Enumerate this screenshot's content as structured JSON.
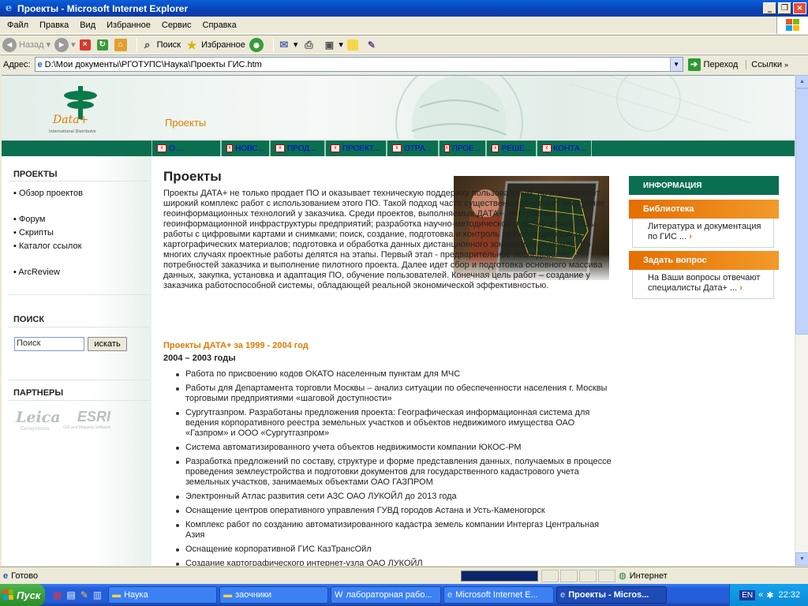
{
  "window": {
    "title": "Проекты - Microsoft Internet Explorer"
  },
  "menu": [
    "Файл",
    "Правка",
    "Вид",
    "Избранное",
    "Сервис",
    "Справка"
  ],
  "toolbar": {
    "back": "Назад",
    "search": "Поиск",
    "favorites": "Избранное"
  },
  "address": {
    "label": "Адрес:",
    "value": "D:\\Мои документы\\РГОТУПС\\Наука\\Проекты ГИС.htm",
    "go": "Переход",
    "links": "Ссылки"
  },
  "page": {
    "logo_text": "Data+",
    "logo_sub": "International Distributor",
    "header_title": "Проекты",
    "nav": [
      "О ...",
      "НОВС...",
      "ПРОД...",
      "ПРОЕКТ...",
      "ОТРА...",
      "ПРОЕ...",
      "РЕШЕ...",
      "КОНТА..."
    ],
    "sidebar": {
      "projects_heading": "ПРОЕКТЫ",
      "projects_links": [
        "Обзор проектов",
        "Форум",
        "Скрипты",
        "Каталог ссылок",
        "ArcReview"
      ],
      "search_heading": "ПОИСК",
      "search_value": "Поиск",
      "search_button": "искать",
      "partners_heading": "ПАРТНЕРЫ",
      "partner1": "Leica",
      "partner1_sub": "Geosystems",
      "partner2": "ESRI",
      "partner2_sub": "GIS and Mapping Software"
    },
    "title": "Проекты",
    "intro": "Проекты ДАТА+ не только продает ПО и оказывает техническую поддержку пользователям, но и выполняет широкий комплекс работ с использованием этого ПО. Такой подход часто существенно облегчает внедрение геоинформационных технологий у заказчика. Среди проектов, выполняемых ДАТА+, построение геоинформационной инфраструктуры предприятий; разработка научно-методической и нормативной базы работы с цифровыми картами и снимками; поиск, создание, подготовка и контроль качества цифровых картографических материалов; подготовка и обработка данных дистанционного зондирования Земли. Во многих случаях проектные работы делятся на этапы. Первый этап - предварительное исследование потребностей заказчика и выполнение пилотного проекта. Далее идет сбор и подготовка основного массива данных, закупка, установка и адаптация ПО, обучение пользователей. Конечная цель работ – создание у заказчика работоспособной системы, обладающей реальной экономической эффективностью.",
    "section_heading": "Проекты ДАТА+ за 1999 - 2004 год",
    "section_sub": "2004 – 2003 годы",
    "items": [
      "Работа по присвоению кодов ОКАТО населенным пунктам для МЧС",
      "Работы для Департамента торговли Москвы – анализ ситуации по обеспеченности населения г. Москвы торговыми предприятиями «шаговой доступности»",
      "Сургутгазпром. Разработаны предложения проекта: Географическая информационная система для ведения корпоративного реестра земельных участков и объектов недвижимого имущества ОАО «Газпром» и ООО «Сургутгазпром»",
      "Система автоматизированного учета объектов недвижимости компании ЮКОС-РМ",
      "Разработка предложений по составу, структуре и форме представления данных, получаемых в процессе проведения землеустройства и подготовки документов для государственного кадастрового учета земельных участков, занимаемых объектами ОАО ГАЗПРОМ",
      "Электронный Атлас развития сети АЗС ОАО ЛУКОЙЛ до 2013 года",
      "Оснащение центров оперативного управления ГУВД городов Астана и Усть-Каменогорск",
      "Комплекс работ по созданию автоматизированного кадастра земель компании Интергаз Центральная Азия",
      "Оснащение корпоративной ГИС КазТрансОйл",
      "Создание картографического интернет-узла ОАО ЛУКОЙЛ"
    ],
    "info": {
      "heading": "ИНФОРМАЦИЯ",
      "lib_title": "Библиотека",
      "lib_text": "Литература и документация по ГИС ...",
      "ask_title": "Задать вопрос",
      "ask_text": "На Ваши вопросы отвечают специалисты Дата+ ..."
    }
  },
  "status": {
    "text": "Готово",
    "zone": "Интернет"
  },
  "taskbar": {
    "start": "Пуск",
    "tasks": [
      "Наука",
      "заочники",
      "лабораторная рабо...",
      "Microsoft Internet E...",
      "Проекты - Micros..."
    ],
    "lang": "EN",
    "clock": "22:32"
  }
}
